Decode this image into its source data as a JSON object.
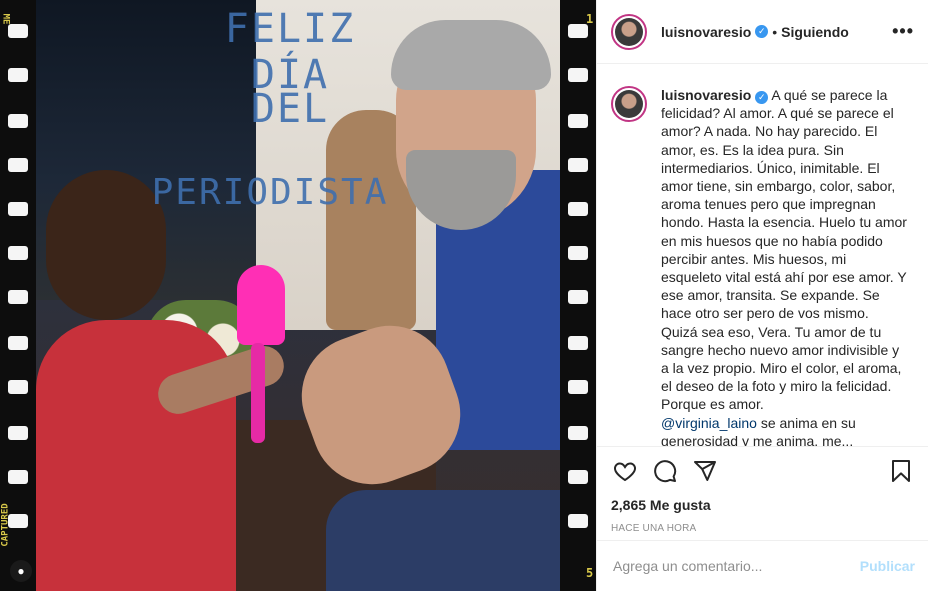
{
  "post": {
    "overlay_lines": [
      "FELIZ DÍA",
      "DEL",
      "PERIODISTA"
    ],
    "film_marks": {
      "top_left": "ME",
      "top_right": "1",
      "bottom_left": "CAPTURED",
      "bottom_right": "5"
    }
  },
  "header": {
    "username": "luisnovaresio",
    "verified_icon": "verified-badge-icon",
    "separator": "•",
    "follow_state": "Siguiendo",
    "more_label": "•••"
  },
  "caption": {
    "username": "luisnovaresio",
    "text": " A qué se parece la felicidad? Al amor. A qué se parece el amor? A nada. No hay parecido. El amor, es. Es la idea pura. Sin intermediarios. Único, inimitable. El amor tiene, sin embargo, color, sabor, aroma tenues pero que impregnan hondo. Hasta la esencia. Huelo tu amor en mis huesos que no había podido percibir antes. Mis huesos, mi esqueleto vital está ahí por ese amor. Y ese amor, transita. Se expande. Se hace otro ser pero de vos mismo. Quizá sea eso, Vera. Tu amor de tu sangre hecho nuevo amor indivisible y a la vez propio. Miro el color, el aroma, el deseo de la foto y miro la felicidad. Porque es amor.",
    "mention": "@virginia_laino",
    "after_mention": " se anima en su generosidad y me anima, me..."
  },
  "actions": {
    "icons": [
      "heart-icon",
      "comment-icon",
      "share-icon",
      "save-icon"
    ],
    "likes": "2,865 Me gusta",
    "timestamp": "HACE UNA HORA"
  },
  "comment": {
    "placeholder": "Agrega un comentario...",
    "publish_label": "Publicar"
  },
  "colors": {
    "verified": "#3897f0",
    "mention": "#00376b",
    "publish_disabled": "#b2dffc",
    "overlay_text": "#3f6fae"
  }
}
